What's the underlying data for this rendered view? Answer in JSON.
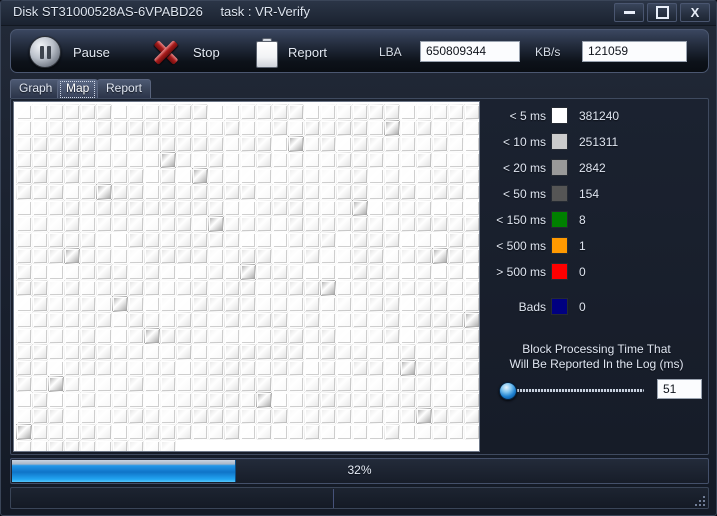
{
  "window": {
    "title_disk": "Disk ST31000528AS-6VPABD26",
    "title_task": "task : VR-Verify",
    "minimize_label": "Minimize",
    "maximize_label": "Maximize",
    "close_label": "X"
  },
  "toolbar": {
    "pause_label": "Pause",
    "stop_label": "Stop",
    "report_label": "Report",
    "lba_label": "LBA",
    "lba_value": "650809344",
    "kbs_label": "KB/s",
    "kbs_value": "121059"
  },
  "tabs": [
    {
      "label": "Graph",
      "selected": false
    },
    {
      "label": "Map",
      "selected": true
    },
    {
      "label": "Report",
      "selected": false
    }
  ],
  "legend": {
    "rows": [
      {
        "name": "< 5 ms",
        "color": "#ffffff",
        "count": "381240"
      },
      {
        "name": "< 10 ms",
        "color": "#cccccc",
        "count": "251311"
      },
      {
        "name": "< 20 ms",
        "color": "#999999",
        "count": "2842"
      },
      {
        "name": "< 50 ms",
        "color": "#555555",
        "count": "154"
      },
      {
        "name": "< 150 ms",
        "color": "#008000",
        "count": "8"
      },
      {
        "name": "< 500 ms",
        "color": "#ff9900",
        "count": "1"
      },
      {
        "name": "> 500 ms",
        "color": "#fe0000",
        "count": "0"
      },
      {
        "name": "Bads",
        "color": "#000080",
        "count": "0"
      }
    ]
  },
  "slider": {
    "title_line1": "Block Processing Time That",
    "title_line2": "Will Be Reported In the Log (ms)",
    "value": "51",
    "position_percent": 3
  },
  "progress": {
    "percent_label": "32%",
    "percent": 32
  },
  "map": {
    "columns": 29,
    "rows": 22,
    "cell_pitch": 16,
    "filled_cells": 619,
    "base_color": "#f0f0f0",
    "dark_cells": [
      [
        5,
        5
      ],
      [
        17,
        2
      ],
      [
        23,
        1
      ],
      [
        12,
        7
      ],
      [
        3,
        9
      ],
      [
        19,
        11
      ],
      [
        8,
        14
      ],
      [
        26,
        9
      ],
      [
        0,
        20
      ],
      [
        15,
        18
      ],
      [
        24,
        16
      ],
      [
        11,
        4
      ],
      [
        21,
        6
      ],
      [
        6,
        12
      ],
      [
        28,
        13
      ],
      [
        2,
        17
      ],
      [
        14,
        10
      ],
      [
        9,
        3
      ],
      [
        18,
        21
      ],
      [
        25,
        19
      ]
    ]
  },
  "statusbar": {
    "pane_left": "",
    "pane_right": ""
  }
}
